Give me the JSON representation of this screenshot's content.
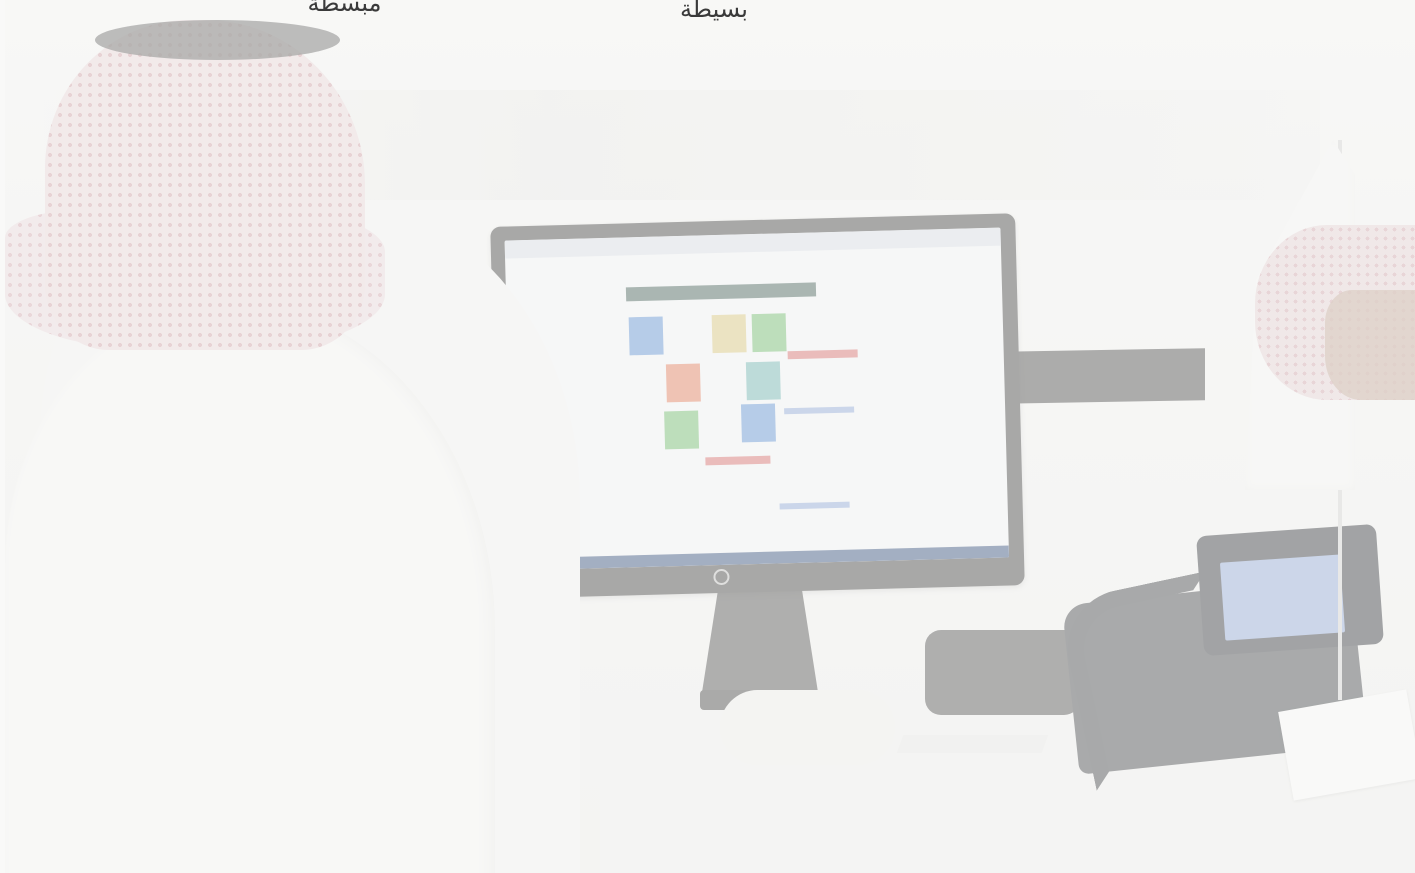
{
  "feature_labels": [
    {
      "text": "مبسطة"
    },
    {
      "text": "بسيطة"
    }
  ],
  "hero_image": {
    "description_icon": "office-photo-icon"
  },
  "colors": {
    "veil": "#f8f8f7",
    "label_text": "#3a3a3a",
    "monitor_frame": "#3b3b3b",
    "phone_screen": "#8fa6d6"
  }
}
